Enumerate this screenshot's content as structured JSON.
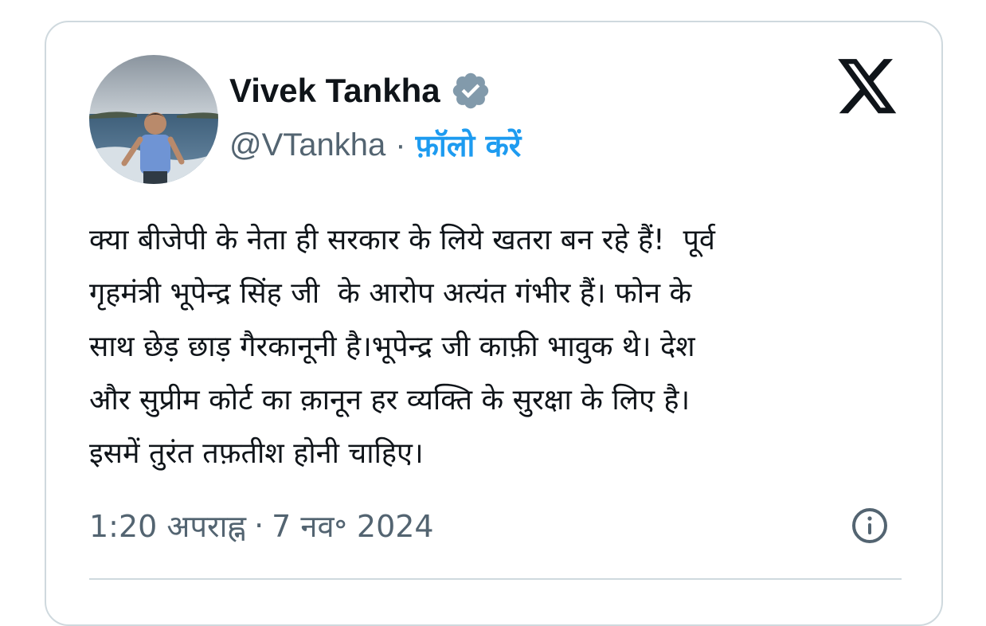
{
  "tweet": {
    "author": {
      "display_name": "Vivek Tankha",
      "handle": "@VTankha",
      "verified_icon": "verified-badge-icon",
      "follow_label": "फ़ॉलो करें"
    },
    "text": "क्या बीजेपी के नेता ही सरकार के लिये खतरा बन रहे हैं!  पूर्व\nगृहमंत्री भूपेन्द्र सिंह जी  के आरोप अत्यंत गंभीर हैं। फोन के\nसाथ छेड़ छाड़ गैरकानूनी है।भूपेन्द्र जी काफ़ी भावुक थे। देश\nऔर सुप्रीम कोर्ट का क़ानून हर व्यक्ति के सुरक्षा के लिए है।\nइसमें तुरंत तफ़तीश होनी चाहिए।",
    "time": "1:20 अपराह्न",
    "date": "7 नव॰ 2024",
    "separator": "·"
  },
  "icons": {
    "platform_logo": "x-logo-icon",
    "info": "info-icon"
  },
  "colors": {
    "text": "#0f1419",
    "secondary": "#536471",
    "link": "#1d9bf0",
    "border": "#cfd9de"
  }
}
